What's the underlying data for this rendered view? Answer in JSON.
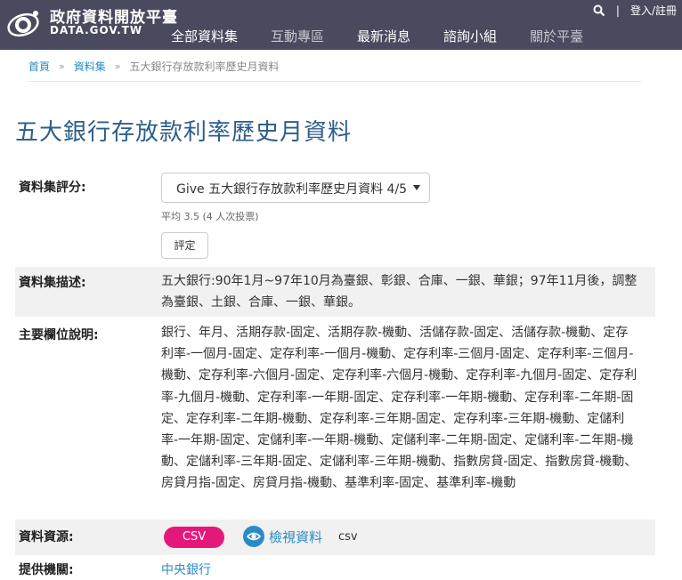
{
  "header": {
    "site_title": "政府資料開放平臺",
    "site_sub": "DATA.GOV.TW",
    "login_label": "登入/註冊",
    "divider": "|",
    "nav": [
      {
        "label": "全部資料集"
      },
      {
        "label": "互動專區"
      },
      {
        "label": "最新消息"
      },
      {
        "label": "諮詢小組"
      },
      {
        "label": "關於平臺"
      }
    ]
  },
  "breadcrumb": {
    "home": "首頁",
    "datasets": "資料集",
    "current": "五大銀行存放款利率歷史月資料",
    "separator": "»"
  },
  "page_title": "五大銀行存放款利率歷史月資料",
  "rating": {
    "label": "資料集評分:",
    "select_value": "Give 五大銀行存放款利率歷史月資料 4/5",
    "average_text": "平均 3.5 (4 人次投票)",
    "rate_button": "評定"
  },
  "description": {
    "label": "資料集描述:",
    "text": "五大銀行:90年1月~97年10月為臺銀、彰銀、合庫、一銀、華銀；97年11月後，調整為臺銀、土銀、合庫、一銀、華銀。"
  },
  "fields": {
    "label": "主要欄位說明:",
    "text": "銀行、年月、活期存款-固定、活期存款-機動、活儲存款-固定、活儲存款-機動、定存利率-一個月-固定、定存利率-一個月-機動、定存利率-三個月-固定、定存利率-三個月-機動、定存利率-六個月-固定、定存利率-六個月-機動、定存利率-九個月-固定、定存利率-九個月-機動、定存利率-一年期-固定、定存利率-一年期-機動、定存利率-二年期-固定、定存利率-二年期-機動、定存利率-三年期-固定、定存利率-三年期-機動、定儲利率-一年期-固定、定儲利率-一年期-機動、定儲利率-二年期-固定、定儲利率-二年期-機動、定儲利率-三年期-固定、定儲利率-三年期-機動、指數房貸-固定、指數房貸-機動、房貸月指-固定、房貸月指-機動、基準利率-固定、基準利率-機動"
  },
  "resources": {
    "label": "資料資源:",
    "csv_button": "CSV",
    "view_label": "檢視資料",
    "format": "csv"
  },
  "provider": {
    "label": "提供機關:",
    "org": "中央銀行"
  },
  "colors": {
    "header_bg": "#4a4a5e",
    "title": "#2c5d8a",
    "link": "#2a8bc4",
    "csv": "#e5187a"
  }
}
